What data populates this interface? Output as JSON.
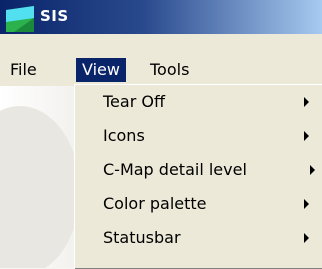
{
  "window": {
    "title": "SIS",
    "icon": "sis-app-icon"
  },
  "menubar": {
    "file": "File",
    "view": "View",
    "tools": "Tools"
  },
  "view_menu": {
    "items": [
      {
        "label": "Tear Off",
        "has_submenu": true
      },
      {
        "label": "Icons",
        "has_submenu": true
      },
      {
        "label": "C-Map detail level",
        "has_submenu": true
      },
      {
        "label": "Color palette",
        "has_submenu": true
      },
      {
        "label": "Statusbar",
        "has_submenu": true
      }
    ]
  },
  "colors": {
    "title_bar": "#0a246a",
    "menu_highlight": "#0a246a",
    "menu_background": "#ece9d8"
  }
}
